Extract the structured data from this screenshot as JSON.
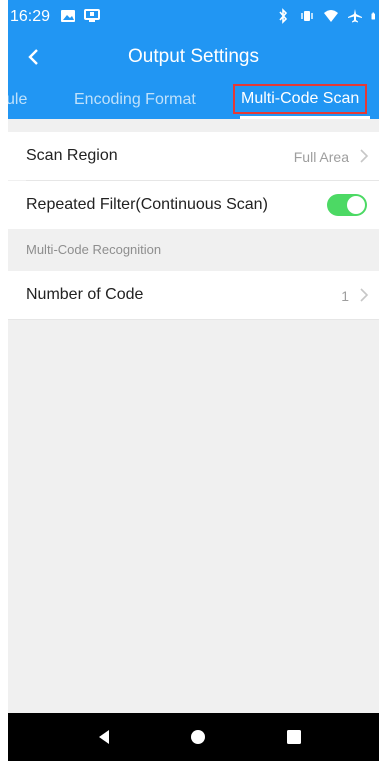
{
  "status_bar": {
    "time": "16:29",
    "icons": [
      "image-icon",
      "screen-share-icon",
      "bluetooth-icon",
      "vibrate-icon",
      "wifi-icon",
      "airplane-icon",
      "battery-icon"
    ]
  },
  "app_bar": {
    "back_icon": "chevron-left-icon",
    "title": "Output Settings"
  },
  "tabs": [
    {
      "label": "ule",
      "selected": false
    },
    {
      "label": "Encoding Format",
      "selected": false
    },
    {
      "label": "Multi-Code Scan",
      "selected": true
    }
  ],
  "settings": {
    "scan_region": {
      "label": "Scan Region",
      "value": "Full Area"
    },
    "repeated_filter": {
      "label": "Repeated Filter(Continuous Scan)",
      "enabled": true
    },
    "section_header": "Multi-Code Recognition",
    "number_of_code": {
      "label": "Number of Code",
      "value": "1"
    }
  },
  "colors": {
    "primary": "#2196f3",
    "toggle_on": "#4cd964",
    "highlight_border": "#e53935"
  },
  "nav_bar": {
    "icons": [
      "back-triangle-icon",
      "home-circle-icon",
      "recents-square-icon"
    ]
  }
}
